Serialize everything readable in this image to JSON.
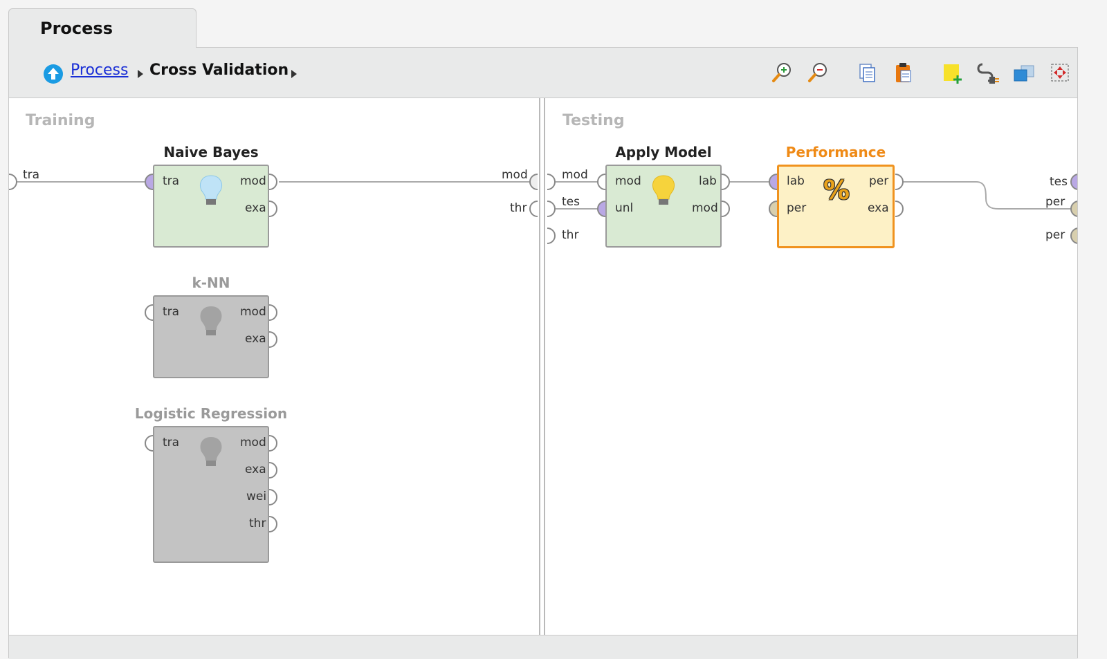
{
  "tab": {
    "title": "Process"
  },
  "breadcrumb": {
    "root": "Process",
    "current": "Cross Validation"
  },
  "toolbar": {
    "icons": [
      "zoom-in-icon",
      "zoom-out-icon",
      "copy-icon",
      "paste-icon",
      "add-note-icon",
      "connect-ports-icon",
      "layers-icon",
      "fit-view-icon"
    ]
  },
  "sections": {
    "training": "Training",
    "testing": "Testing"
  },
  "operators": {
    "naive_bayes": {
      "title": "Naive Bayes",
      "in": [
        "tra"
      ],
      "out": [
        "mod",
        "exa"
      ]
    },
    "knn": {
      "title": "k-NN",
      "in": [
        "tra"
      ],
      "out": [
        "mod",
        "exa"
      ]
    },
    "logistic_regression": {
      "title": "Logistic Regression",
      "in": [
        "tra"
      ],
      "out": [
        "mod",
        "exa",
        "wei",
        "thr"
      ]
    },
    "apply_model": {
      "title": "Apply Model",
      "in": [
        "mod",
        "unl"
      ],
      "out": [
        "lab",
        "mod"
      ]
    },
    "performance": {
      "title": "Performance",
      "in": [
        "lab",
        "per"
      ],
      "out": [
        "per",
        "exa"
      ],
      "icon_text": "%"
    }
  },
  "training_ports": {
    "left": [
      "tra"
    ],
    "right": [
      "mod",
      "thr"
    ]
  },
  "testing_ports": {
    "left": [
      "mod",
      "tes",
      "thr"
    ],
    "right": [
      "tes",
      "per",
      "per"
    ]
  },
  "colors": {
    "active_op": "#d9ead3",
    "disabled_op": "#c3c3c3",
    "performance_op": "#fdf1c6",
    "performance_border": "#f0921e",
    "performance_title": "#ef8a16",
    "disabled_title": "#9a9a9a",
    "link": "#1a2fd6"
  }
}
